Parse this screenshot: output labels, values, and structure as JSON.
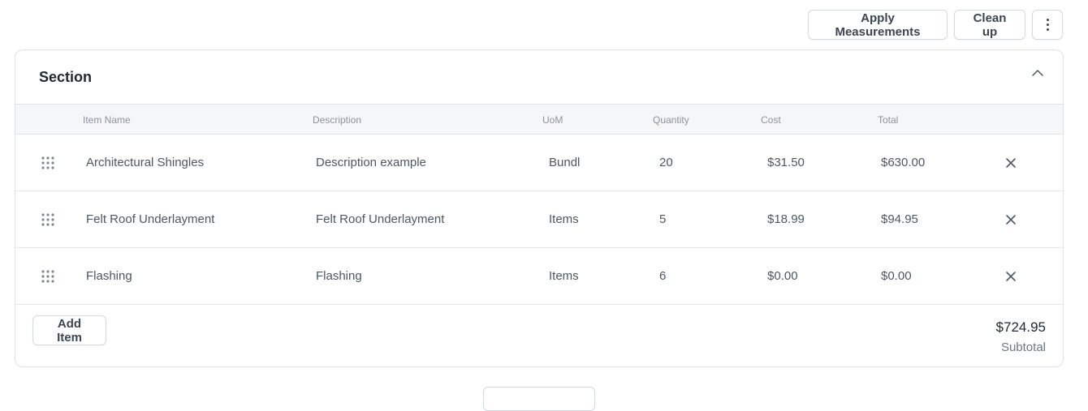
{
  "toolbar": {
    "apply_label": "Apply Measurements",
    "clean_label": "Clean up",
    "more_icon": "kebab-vertical-icon"
  },
  "section": {
    "title": "Section",
    "collapse_icon": "chevron-up-icon"
  },
  "table": {
    "headers": [
      "Item Name",
      "Description",
      "UoM",
      "Quantity",
      "Cost",
      "Total"
    ],
    "rows": [
      {
        "name": "Architectural Shingles",
        "description": "Description example",
        "uom": "Bundl",
        "quantity": "20",
        "cost": "$31.50",
        "total": "$630.00"
      },
      {
        "name": "Felt Roof Underlayment",
        "description": "Felt Roof Underlayment",
        "uom": "Items",
        "quantity": "5",
        "cost": "$18.99",
        "total": "$94.95"
      },
      {
        "name": "Flashing",
        "description": "Flashing",
        "uom": "Items",
        "quantity": "6",
        "cost": "$0.00",
        "total": "$0.00"
      }
    ]
  },
  "footer": {
    "add_label": "Add Item",
    "subtotal_value": "$724.95",
    "subtotal_label": "Subtotal"
  },
  "colors": {
    "border": "#dfe3e7",
    "header_bg": "#f4f6f8",
    "text": "#4b5863",
    "muted": "#8a949d"
  }
}
